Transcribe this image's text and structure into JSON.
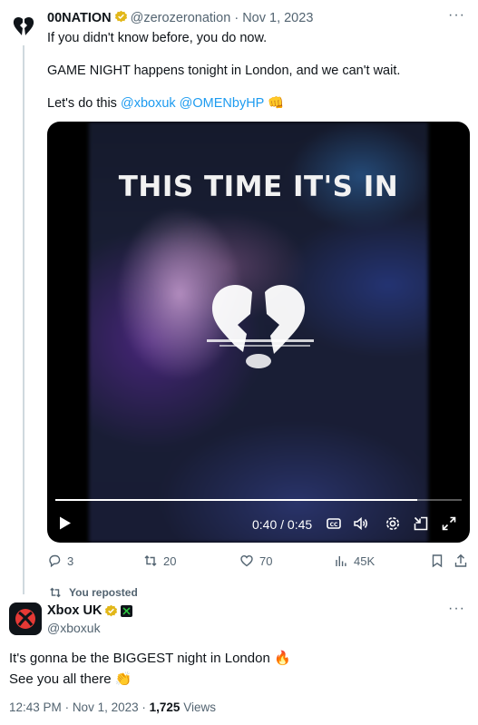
{
  "tweet": {
    "author_name": "00NATION",
    "handle": "@zerozeronation",
    "separator": "·",
    "date": "Nov 1, 2023",
    "more": "···",
    "line1": "If you didn't know before, you do now.",
    "line2": "GAME NIGHT happens tonight in London, and we can't wait.",
    "line3_prefix": "Let's do this ",
    "mention1": "@xboxuk",
    "mention2": "@OMENbyHP",
    "line3_emoji": "👊"
  },
  "video": {
    "overlay_text": "THIS TIME IT'S IN",
    "time": "0:40 / 0:45",
    "progress": 0.89
  },
  "actions": {
    "replies": "3",
    "reposts": "20",
    "likes": "70",
    "views": "45K"
  },
  "repost": {
    "label": "You reposted",
    "name": "Xbox UK",
    "handle": "@xboxuk",
    "more": "···",
    "line1": "It's gonna be the BIGGEST night in London 🔥",
    "line2": "See you all there 👏",
    "time": "12:43 PM",
    "date": "Nov 1, 2023",
    "views_count": "1,725",
    "views_label": "Views"
  },
  "colors": {
    "accent": "#1d9bf0",
    "muted": "#536471",
    "verified_gold": "#e2b719"
  }
}
